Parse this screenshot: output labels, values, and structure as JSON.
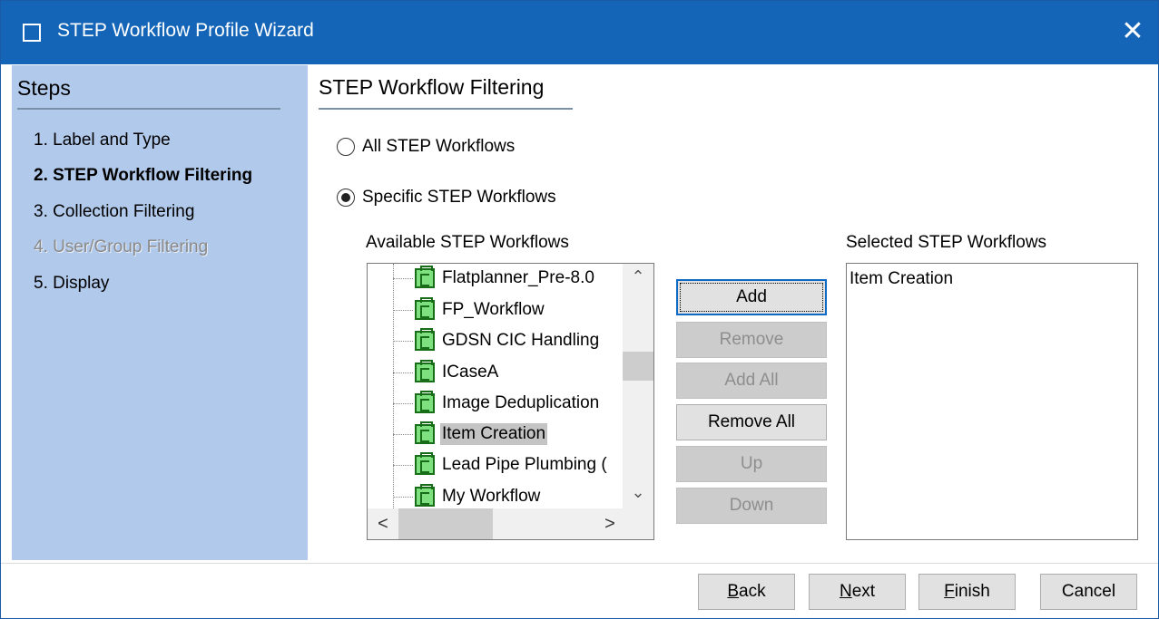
{
  "window": {
    "title": "STEP Workflow Profile Wizard",
    "close_glyph": "✕"
  },
  "sidebar": {
    "title": "Steps",
    "steps": [
      {
        "label": "1. Label and Type",
        "state": "normal"
      },
      {
        "label": "2. STEP Workflow Filtering",
        "state": "current"
      },
      {
        "label": "3. Collection Filtering",
        "state": "normal"
      },
      {
        "label": "4. User/Group Filtering",
        "state": "disabled"
      },
      {
        "label": "5. Display",
        "state": "normal"
      }
    ]
  },
  "main": {
    "title": "STEP Workflow Filtering",
    "radio_all": {
      "label": "All STEP Workflows",
      "checked": false
    },
    "radio_specific": {
      "label": "Specific STEP Workflows",
      "checked": true
    },
    "available_label": "Available STEP Workflows",
    "selected_label": "Selected STEP Workflows",
    "available_items": [
      {
        "label": "Flatplanner_Pre-8.0",
        "selected": false
      },
      {
        "label": "FP_Workflow",
        "selected": false
      },
      {
        "label": "GDSN CIC Handling",
        "selected": false
      },
      {
        "label": "ICaseA",
        "selected": false
      },
      {
        "label": "Image Deduplication",
        "selected": false
      },
      {
        "label": "Item Creation",
        "selected": true
      },
      {
        "label": "Lead Pipe Plumbing (",
        "selected": false
      },
      {
        "label": "My Workflow",
        "selected": false
      }
    ],
    "selected_items": [
      "Item Creation"
    ],
    "scroll": {
      "up": "⌃",
      "down": "⌄",
      "left": "<",
      "right": ">"
    }
  },
  "controls": {
    "add": "Add",
    "remove": "Remove",
    "add_all": "Add All",
    "remove_all": "Remove All",
    "up": "Up",
    "down": "Down"
  },
  "footer": {
    "back": {
      "mnemonic": "B",
      "rest": "ack"
    },
    "next": {
      "mnemonic": "N",
      "rest": "ext"
    },
    "finish": {
      "mnemonic": "F",
      "rest": "inish"
    },
    "cancel": "Cancel"
  }
}
